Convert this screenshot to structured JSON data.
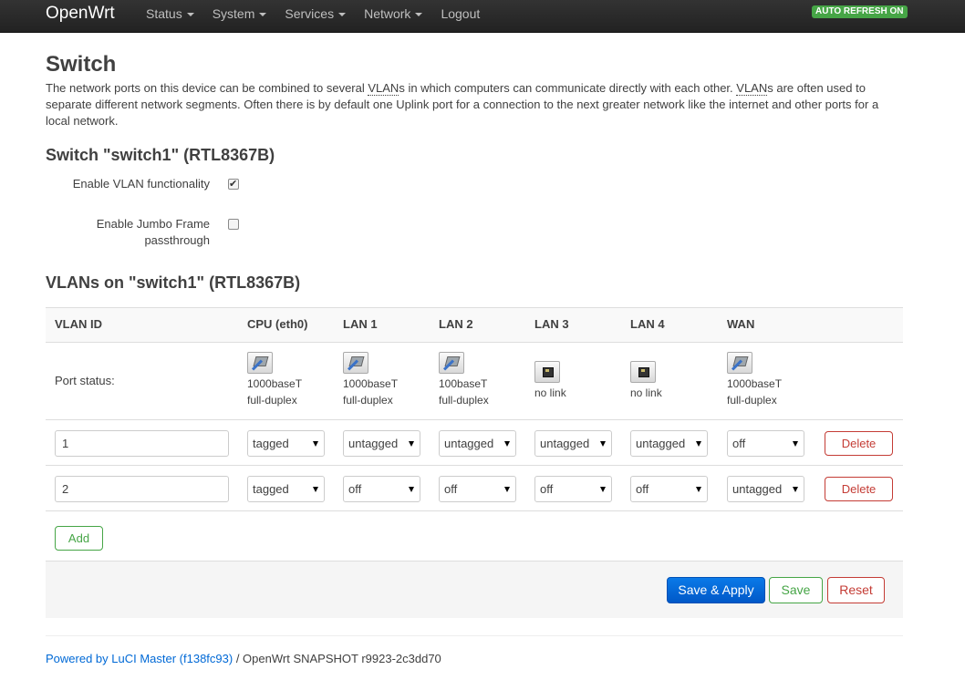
{
  "navbar": {
    "brand": "OpenWrt",
    "items": [
      {
        "label": "Status",
        "dropdown": true
      },
      {
        "label": "System",
        "dropdown": true
      },
      {
        "label": "Services",
        "dropdown": true
      },
      {
        "label": "Network",
        "dropdown": true
      },
      {
        "label": "Logout",
        "dropdown": false
      }
    ],
    "auto_refresh": "AUTO REFRESH ON"
  },
  "page": {
    "title": "Switch",
    "desc_part1": "The network ports on this device can be combined to several ",
    "vlan_abbr": "VLAN",
    "desc_part2": "s in which computers can communicate directly with each other. ",
    "desc_part3": "s are often used to separate different network segments. Often there is by default one Uplink port for a connection to the next greater network like the internet and other ports for a local network."
  },
  "switch_section": {
    "title": "Switch \"switch1\" (RTL8367B)",
    "enable_vlan_label": "Enable VLAN functionality",
    "enable_vlan_checked": true,
    "jumbo_label_line1": "Enable Jumbo Frame",
    "jumbo_label_line2": "passthrough",
    "jumbo_checked": false
  },
  "vlans_section": {
    "title": "VLANs on \"switch1\" (RTL8367B)",
    "headers": {
      "vlan_id": "VLAN ID",
      "cpu": "CPU (eth0)",
      "lan1": "LAN 1",
      "lan2": "LAN 2",
      "lan3": "LAN 3",
      "lan4": "LAN 4",
      "wan": "WAN"
    },
    "port_status_label": "Port status:",
    "port_status": {
      "cpu": {
        "link": "up",
        "line1": "1000baseT",
        "line2": "full-duplex"
      },
      "lan1": {
        "link": "up",
        "line1": "1000baseT",
        "line2": "full-duplex"
      },
      "lan2": {
        "link": "up",
        "line1": "100baseT",
        "line2": "full-duplex"
      },
      "lan3": {
        "link": "down",
        "line1": "no link",
        "line2": ""
      },
      "lan4": {
        "link": "down",
        "line1": "no link",
        "line2": ""
      },
      "wan": {
        "link": "up",
        "line1": "1000baseT",
        "line2": "full-duplex"
      }
    },
    "rows": [
      {
        "vlan_id": "1",
        "cpu": "tagged",
        "lan1": "untagged",
        "lan2": "untagged",
        "lan3": "untagged",
        "lan4": "untagged",
        "wan": "off"
      },
      {
        "vlan_id": "2",
        "cpu": "tagged",
        "lan1": "off",
        "lan2": "off",
        "lan3": "off",
        "lan4": "off",
        "wan": "untagged"
      }
    ],
    "delete_label": "Delete",
    "add_label": "Add"
  },
  "actions": {
    "save_apply": "Save & Apply",
    "save": "Save",
    "reset": "Reset"
  },
  "footer": {
    "powered_by": "Powered by LuCI Master (f138fc93)",
    "version": " / OpenWrt SNAPSHOT r9923-2c3dd70"
  },
  "colors": {
    "navbar_bg": "#222222",
    "auto_refresh_bg": "#46a546",
    "primary_button": "#0069d6",
    "positive": "#46a546",
    "negative": "#c43c35",
    "link": "#0069d6"
  }
}
